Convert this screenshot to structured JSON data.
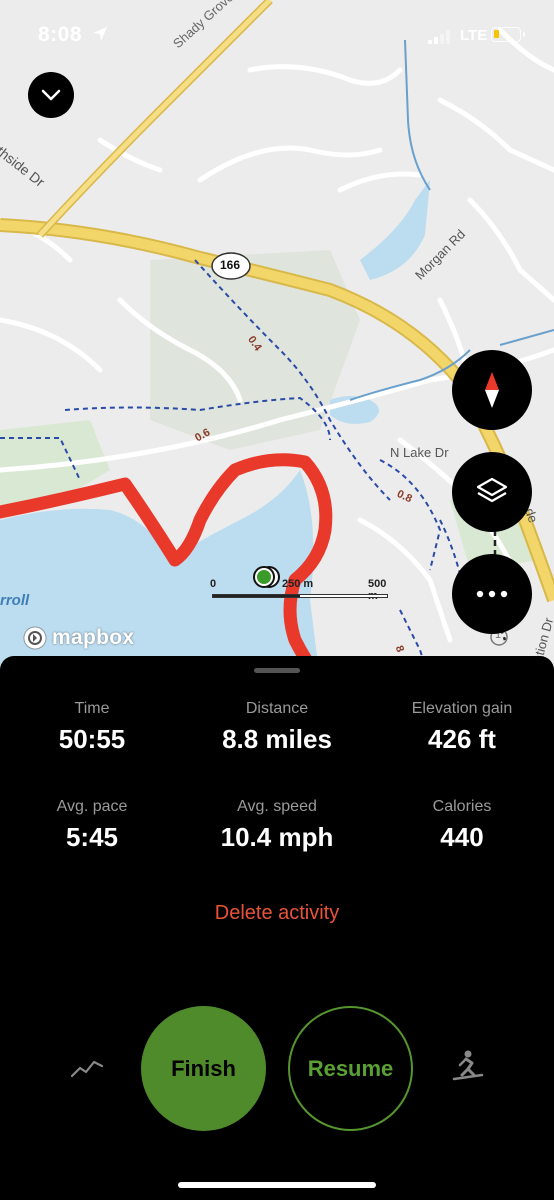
{
  "status_bar": {
    "time": "8:08",
    "carrier": "LTE"
  },
  "map": {
    "labels": {
      "shady_grove": "Shady Grove",
      "northside": "rthside Dr",
      "route": "166",
      "morgan": "Morgan Rd",
      "n_lake": "N Lake Dr",
      "lake": "rroll",
      "station": "ation Dr",
      "d04": "0.4",
      "d06": "0.6",
      "d08": "0.8",
      "d8b": "8",
      "circle1": "1",
      "edge_de": "de"
    },
    "scale": {
      "zero": "0",
      "mid": "250 m",
      "max": "500 m"
    },
    "attribution": "mapbox",
    "buttons": [
      "chevron-down-icon",
      "compass-icon",
      "layers-icon",
      "more-icon"
    ]
  },
  "panel": {
    "stats": [
      {
        "label": "Time",
        "value": "50:55"
      },
      {
        "label": "Distance",
        "value": "8.8 miles"
      },
      {
        "label": "Elevation gain",
        "value": "426 ft"
      },
      {
        "label": "Avg. pace",
        "value": "5:45"
      },
      {
        "label": "Avg. speed",
        "value": "10.4 mph"
      },
      {
        "label": "Calories",
        "value": "440"
      }
    ],
    "delete_label": "Delete activity",
    "finish_label": "Finish",
    "resume_label": "Resume"
  },
  "colors": {
    "track": "#e8392b",
    "finish": "#4f8a2b",
    "resume": "#5ba033",
    "delete": "#e8533a"
  }
}
